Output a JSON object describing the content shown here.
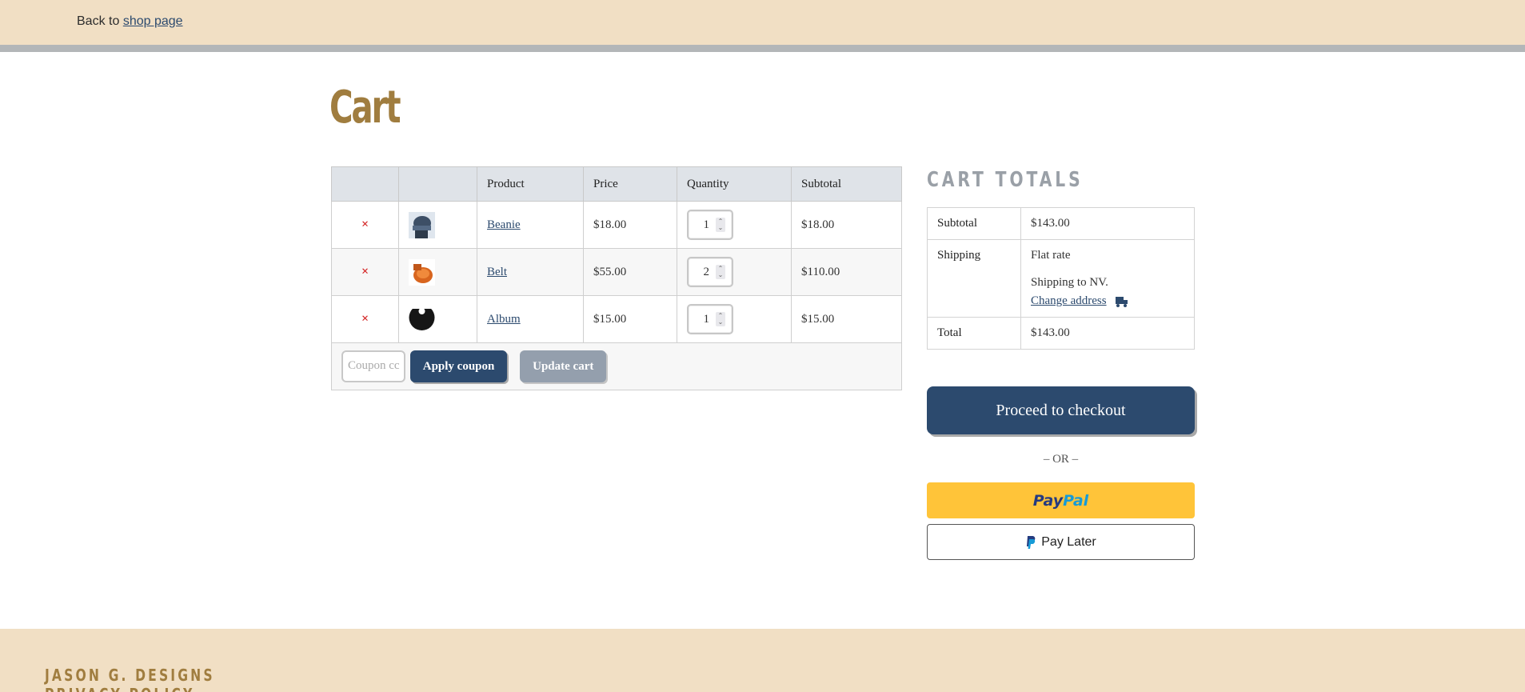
{
  "header": {
    "back_prefix": "Back to",
    "back_link": "shop page"
  },
  "page": {
    "title": "Cart"
  },
  "cart_table": {
    "columns": [
      "",
      "",
      "Product",
      "Price",
      "Quantity",
      "Subtotal"
    ],
    "rows": [
      {
        "remove": "×",
        "thumb_icon": "beanie-thumbnail",
        "product": "Beanie",
        "price": "$18.00",
        "quantity": "1",
        "subtotal": "$18.00"
      },
      {
        "remove": "×",
        "thumb_icon": "belt-thumbnail",
        "product": "Belt",
        "price": "$55.00",
        "quantity": "2",
        "subtotal": "$110.00"
      },
      {
        "remove": "×",
        "thumb_icon": "album-thumbnail",
        "product": "Album",
        "price": "$15.00",
        "quantity": "1",
        "subtotal": "$15.00"
      }
    ],
    "coupon_placeholder": "Coupon code",
    "coupon_visible": "Coupon cc",
    "apply_coupon": "Apply coupon",
    "update_cart": "Update cart"
  },
  "totals": {
    "title": "CART TOTALS",
    "subtotal_label": "Subtotal",
    "subtotal_value": "$143.00",
    "shipping_label": "Shipping",
    "shipping_method": "Flat rate",
    "shipping_to": "Shipping to NV.",
    "change_address": "Change address",
    "total_label": "Total",
    "total_value": "$143.00"
  },
  "checkout": {
    "proceed": "Proceed to checkout",
    "or": "– OR –",
    "paypal_pay": "Pay",
    "paypal_pal": "Pal",
    "pay_later": "Pay Later"
  },
  "footer": {
    "brand": "JASON G. DESIGNS",
    "sub": "PRIVACY POLICY"
  },
  "colors": {
    "accent": "#a07d3f",
    "primary_button": "#2c4a6e",
    "paypal_yellow": "#ffc439",
    "band": "#f1dfc4"
  }
}
